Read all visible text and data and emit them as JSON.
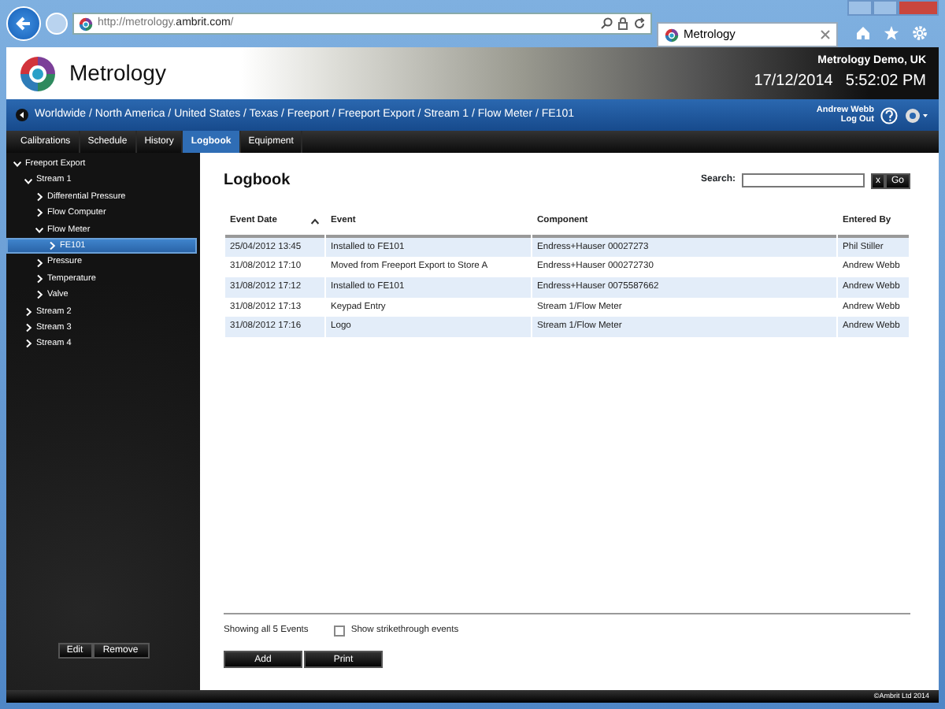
{
  "browser": {
    "address": "http://metrology.**ambrit.com**/",
    "tab_title": "Metrology"
  },
  "header": {
    "app_name": "Metrology",
    "site": "Metrology Demo, UK",
    "date": "17/12/2014",
    "time": "5:52:02 PM"
  },
  "breadcrumb": "Worldwide / North America / United States / Texas / Freeport / Freeport Export / Stream 1 / Flow Meter / FE101",
  "user": {
    "name": "Andrew Webb",
    "logout": "Log Out"
  },
  "tabs": [
    {
      "label": "Calibrations",
      "selected": false
    },
    {
      "label": "Schedule",
      "selected": false
    },
    {
      "label": "History",
      "selected": false
    },
    {
      "label": "Logbook",
      "selected": true
    },
    {
      "label": "Equipment",
      "selected": false
    }
  ],
  "tree": [
    {
      "label": "Freeport Export",
      "expanded": true,
      "selected": false,
      "children": [
        {
          "label": "Stream 1",
          "expanded": true,
          "selected": false,
          "children": [
            {
              "label": "Differential Pressure",
              "expanded": false,
              "selected": false
            },
            {
              "label": "Flow Computer",
              "expanded": false,
              "selected": false
            },
            {
              "label": "Flow Meter",
              "expanded": true,
              "selected": false,
              "children": [
                {
                  "label": "FE101",
                  "expanded": false,
                  "selected": true
                }
              ]
            },
            {
              "label": "Pressure",
              "expanded": false,
              "selected": false
            },
            {
              "label": "Temperature",
              "expanded": false,
              "selected": false
            },
            {
              "label": "Valve",
              "expanded": false,
              "selected": false
            }
          ]
        },
        {
          "label": "Stream 2",
          "expanded": false,
          "selected": false
        },
        {
          "label": "Stream 3",
          "expanded": false,
          "selected": false
        },
        {
          "label": "Stream 4",
          "expanded": false,
          "selected": false
        }
      ]
    }
  ],
  "sidebar_buttons": [
    "Edit",
    "Remove"
  ],
  "logbook": {
    "title": "Logbook",
    "search_label": "Search:",
    "clear_button": "x",
    "go_button": "Go",
    "columns": [
      {
        "label": "Event Date",
        "sorted": true
      },
      {
        "label": "Event",
        "sorted": false
      },
      {
        "label": "Component",
        "sorted": false
      },
      {
        "label": "Entered By",
        "sorted": false
      }
    ],
    "rows": [
      [
        "25/04/2012 13:45",
        "Installed to FE101",
        "Endress+Hauser 00027273",
        "Phil Stiller"
      ],
      [
        "31/08/2012 17:10",
        "Moved from Freeport Export to Store A",
        "Endress+Hauser 000272730",
        "Andrew Webb"
      ],
      [
        "31/08/2012 17:12",
        "Installed to FE101",
        "Endress+Hauser 0075587662",
        "Andrew Webb"
      ],
      [
        "31/08/2012 17:13",
        "Keypad Entry",
        "Stream 1/Flow Meter",
        "Andrew Webb"
      ],
      [
        "31/08/2012 17:16",
        "Logo",
        "Stream 1/Flow Meter",
        "Andrew Webb"
      ]
    ],
    "status": "Showing all 5 Events",
    "strikethrough": {
      "label": "Show strikethrough events",
      "checked": false
    },
    "buttons": [
      "Add",
      "Print"
    ]
  },
  "footer": "©Ambrit Ltd 2014"
}
